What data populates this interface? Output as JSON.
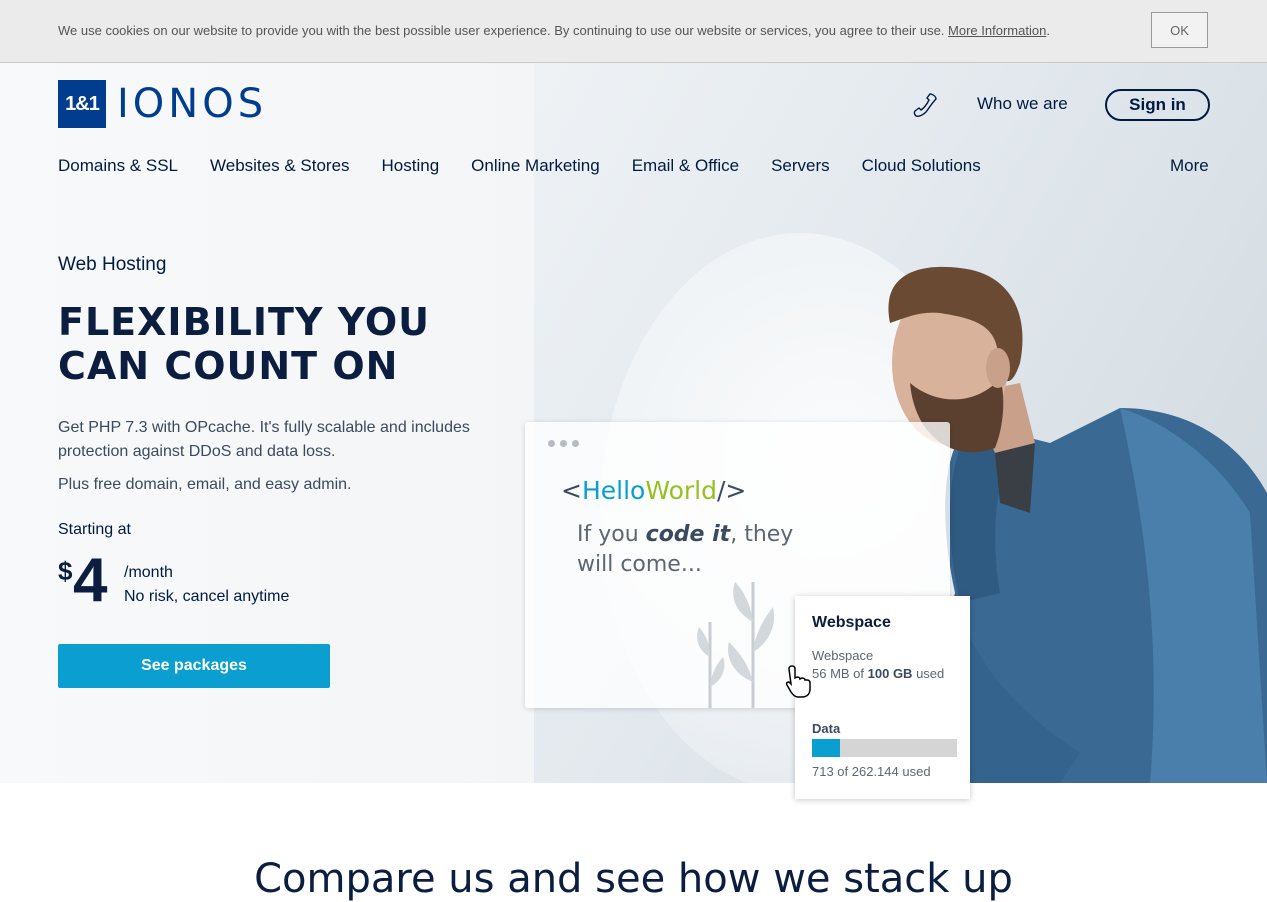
{
  "cookie": {
    "text": "We use cookies on our website to provide you with the best possible user experience. By continuing to use our website or services, you agree to their use.",
    "link": "More Information",
    "ok": "OK"
  },
  "header": {
    "logo_mark": "1&1",
    "logo_word": "IONOS",
    "who_we_are": "Who we are",
    "sign_in": "Sign in"
  },
  "nav": {
    "items": [
      "Domains & SSL",
      "Websites & Stores",
      "Hosting",
      "Online Marketing",
      "Email & Office",
      "Servers",
      "Cloud Solutions"
    ],
    "more": "More"
  },
  "hero": {
    "eyebrow": "Web Hosting",
    "headline": "FLEXIBILITY YOU CAN COUNT ON",
    "description": "Get PHP 7.3 with OPcache. It's fully scalable and includes protection against DDoS and data loss.",
    "description2": "Plus free domain, email, and easy admin.",
    "starting_at": "Starting at",
    "currency": "$",
    "price": "4",
    "per": "/month",
    "no_risk": "No risk, cancel anytime",
    "cta": "See packages"
  },
  "code_card": {
    "open": "<",
    "hello": "Hello",
    "world": "World",
    "close": "/>",
    "tag_pre": "If you ",
    "tag_bold": "code it",
    "tag_post": ", they will come..."
  },
  "stats_card": {
    "title": "Webspace",
    "label": "Webspace",
    "used_pre": "56 MB of ",
    "used_bold": "100 GB",
    "used_post": " used",
    "data_label": "Data",
    "data_used": "713 of 262.144 used",
    "data_fraction": 0.19
  },
  "colors": {
    "brand": "#003d8f",
    "accent": "#0b9ed0",
    "green": "#95c11f",
    "text": "#001b41"
  },
  "section": {
    "compare": "Compare us and see how we stack up"
  }
}
